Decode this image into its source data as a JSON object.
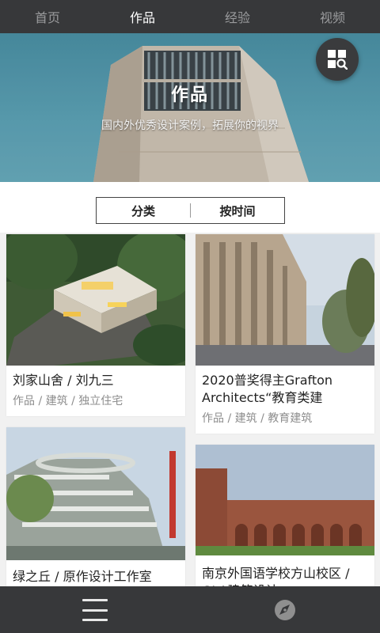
{
  "nav": {
    "tabs": [
      {
        "label": "首页"
      },
      {
        "label": "作品"
      },
      {
        "label": "经验"
      },
      {
        "label": "视频"
      }
    ],
    "active_index": 1
  },
  "hero": {
    "title": "作品",
    "subtitle": "国内外优秀设计案例，拓展你的视界",
    "fab_icon": "grid-search-icon"
  },
  "filter": {
    "category_label": "分类",
    "time_label": "按时间"
  },
  "cards": [
    {
      "title": "刘家山舍 / 刘九三",
      "tags": "作品 / 建筑 / 独立住宅"
    },
    {
      "title": "2020普奖得主Grafton Architects“教育类建",
      "tags": "作品 / 建筑 / 教育建筑"
    },
    {
      "title": "绿之丘 / 原作设计工作室",
      "tags": ""
    },
    {
      "title": "南京外国语学校方山校区 / GLA建筑设计",
      "tags": ""
    }
  ],
  "bottom": {
    "menu_icon": "hamburger-menu-icon",
    "compass_icon": "compass-icon"
  },
  "colors": {
    "bar_bg": "#37383a",
    "nav_inactive": "#9a9b9d",
    "nav_active": "#ffffff",
    "tag_gray": "#8d8d8d"
  }
}
